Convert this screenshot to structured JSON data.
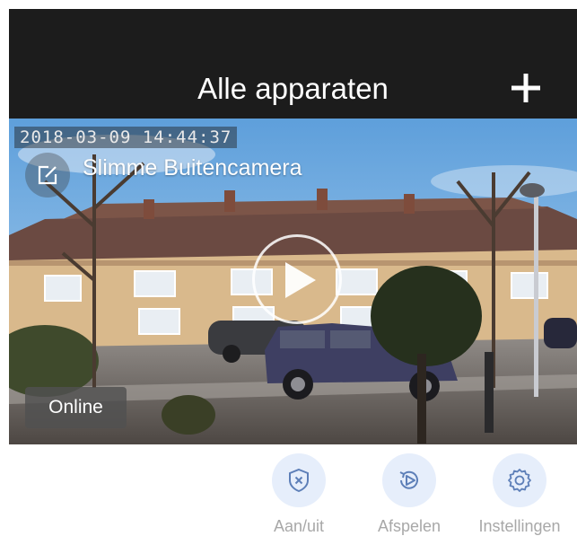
{
  "header": {
    "title": "Alle apparaten",
    "add_icon": "plus-icon"
  },
  "camera": {
    "timestamp": "2018-03-09  14:44:37",
    "name": "Slimme Buitencamera",
    "edit_icon": "edit-icon",
    "play_icon": "play-icon",
    "status": "Online"
  },
  "actions": [
    {
      "label": "Aan/uit",
      "icon": "shield-x-icon"
    },
    {
      "label": "Afspelen",
      "icon": "replay-icon"
    },
    {
      "label": "Instellingen",
      "icon": "gear-icon"
    }
  ],
  "colors": {
    "header_bg": "#1c1c1c",
    "action_circle_bg": "#e6eefb",
    "action_icon": "#5d7fb8",
    "action_label": "#a8a8a8"
  }
}
